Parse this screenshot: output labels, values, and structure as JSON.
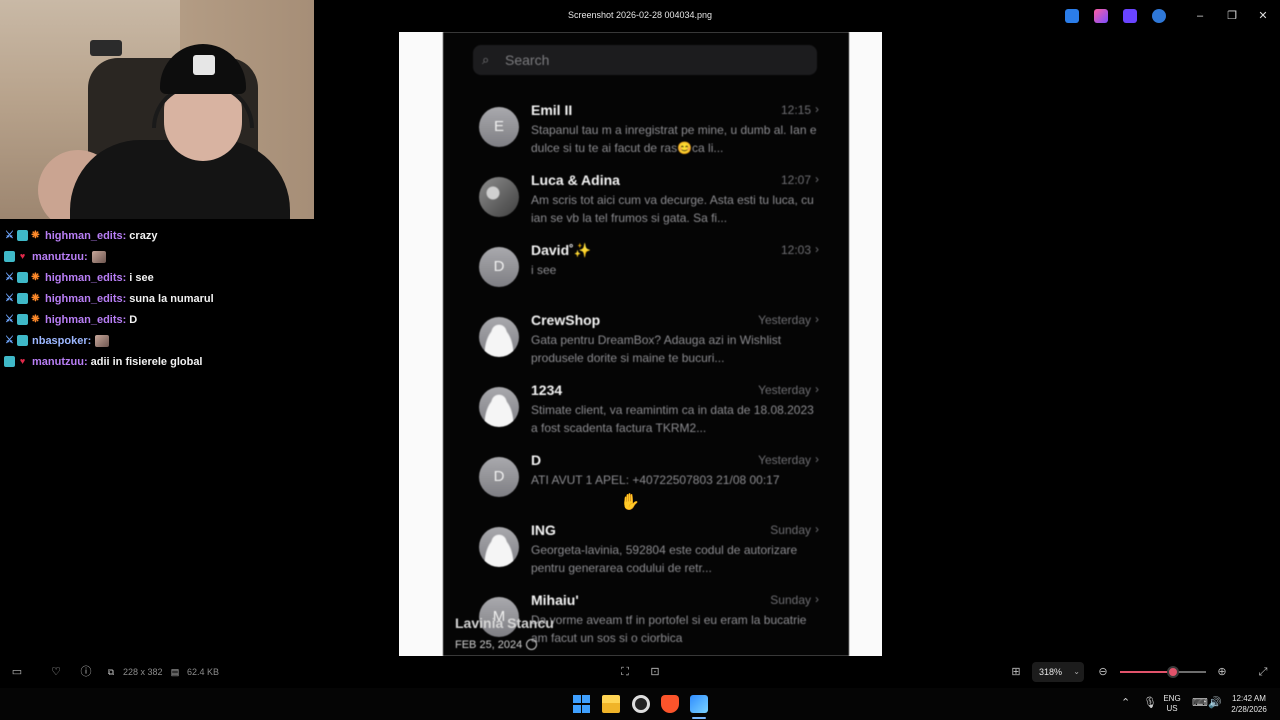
{
  "window": {
    "title": "Screenshot 2026-02-28 004034.png",
    "controls": {
      "minimize": "–",
      "restore": "❐",
      "close": "✕"
    }
  },
  "chat": [
    {
      "badges": [
        "sword",
        "sub",
        "gift"
      ],
      "user": "highman_edits",
      "user_color": "#b87ef5",
      "message": "crazy",
      "emote": false
    },
    {
      "badges": [
        "sub",
        "heart"
      ],
      "user": "manutzuu",
      "user_color": "#b87ef5",
      "message": "",
      "emote": true
    },
    {
      "badges": [
        "sword",
        "sub",
        "gift"
      ],
      "user": "highman_edits",
      "user_color": "#b87ef5",
      "message": "i see",
      "emote": false
    },
    {
      "badges": [
        "sword",
        "sub",
        "gift"
      ],
      "user": "highman_edits",
      "user_color": "#b87ef5",
      "message": "suna la numarul",
      "emote": false
    },
    {
      "badges": [
        "sword",
        "sub",
        "gift"
      ],
      "user": "highman_edits",
      "user_color": "#b87ef5",
      "message": "D",
      "emote": false
    },
    {
      "badges": [
        "sword",
        "sub"
      ],
      "user": "nbaspoker",
      "user_color": "#9cb7ff",
      "message": "",
      "emote": true
    },
    {
      "badges": [
        "sub",
        "heart"
      ],
      "user": "manutzuu",
      "user_color": "#b87ef5",
      "message": "adii in fisierele global",
      "emote": false
    }
  ],
  "phone": {
    "search_placeholder": "Search",
    "conversations": [
      {
        "avatar": "E",
        "avatar_style": "letter",
        "name": "Emil II",
        "time": "12:15",
        "preview": "Stapanul tau m a inregistrat pe mine, u dumb al. Ian e dulce si tu te ai facut de ras😊ca li..."
      },
      {
        "avatar": "",
        "avatar_style": "photo",
        "name": "Luca & Adina",
        "time": "12:07",
        "preview": "Am scris tot aici cum va decurge. Asta esti tu luca, cu ian se vb la tel frumos si gata. Sa fi..."
      },
      {
        "avatar": "D",
        "avatar_style": "letter",
        "name": "David˚✨",
        "time": "12:03",
        "preview": "i see"
      },
      {
        "avatar": "",
        "avatar_style": "person",
        "name": "CrewShop",
        "time": "Yesterday",
        "preview": "Gata pentru DreamBox? Adauga azi in Wishlist produsele dorite si maine te bucuri..."
      },
      {
        "avatar": "",
        "avatar_style": "person",
        "name": "1234",
        "time": "Yesterday",
        "preview": "Stimate client, va reamintim ca in data de 18.08.2023 a fost scadenta factura TKRM2..."
      },
      {
        "avatar": "D",
        "avatar_style": "letter",
        "name": "D",
        "time": "Yesterday",
        "preview": "ATI AVUT 1 APEL: +40722507803 21/08 00:17"
      },
      {
        "avatar": "",
        "avatar_style": "person",
        "name": "ING",
        "time": "Sunday",
        "preview": "Georgeta-lavinia, 592804 este codul de autorizare pentru generarea codului de retr..."
      },
      {
        "avatar": "M",
        "avatar_style": "letter",
        "name": "Mihaiu'",
        "time": "Sunday",
        "preview": "Da vorme aveam tf in portofel si eu eram la bucatrie am facut un sos si o ciorbica"
      }
    ],
    "caption_name": "Lavinia Stancu",
    "caption_date": "FEB 25, 2024"
  },
  "viewbar": {
    "dimensions": "228 x 382",
    "filesize": "62.4 KB",
    "zoom": "318%",
    "zoom_fraction": 0.62
  },
  "tray": {
    "lang_line1": "ENG",
    "lang_line2": "US",
    "time": "12:42 AM",
    "date": "2/28/2026"
  },
  "colors": {
    "accent": "#e2536b",
    "sub_badge": "#3fb9c8"
  }
}
